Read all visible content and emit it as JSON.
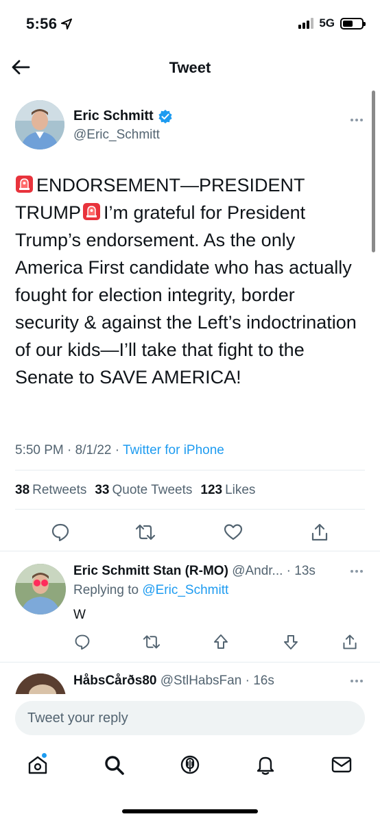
{
  "status_bar": {
    "time": "5:56",
    "network": "5G",
    "battery_level": 0.55
  },
  "header": {
    "title": "Tweet"
  },
  "tweet": {
    "display_name": "Eric Schmitt",
    "handle": "@Eric_Schmitt",
    "verified": true,
    "text_line1": "ENDORSEMENT—PRESIDENT",
    "text_line2_a": "TRUMP",
    "text_line2_b": "I’m grateful for President",
    "text_rest": "Trump’s endorsement. As the only America First candidate who has actually fought for election integrity, border security & against the Left’s indoctrination of our kids—I’ll take that fight to the Senate to SAVE AMERICA!",
    "time": "5:50 PM",
    "date": "8/1/22",
    "source": "Twitter for iPhone",
    "retweets_count": "38",
    "retweets_label": "Retweets",
    "quotes_count": "33",
    "quotes_label": "Quote Tweets",
    "likes_count": "123",
    "likes_label": "Likes"
  },
  "replies": [
    {
      "display_name": "Eric Schmitt Stan (R-MO)",
      "handle": "@Andr...",
      "age": "13s",
      "replying_label": "Replying to",
      "replying_to": "@Eric_Schmitt",
      "text": "W"
    },
    {
      "display_name": "HåbsCårðs80",
      "handle": "@StlHabsFan",
      "age": "16s"
    }
  ],
  "composer": {
    "placeholder": "Tweet your reply"
  },
  "tabs": [
    "home-icon",
    "search-icon",
    "spaces-icon",
    "notifications-icon",
    "messages-icon"
  ],
  "colors": {
    "accent": "#1d9bf0",
    "muted": "#536471",
    "text": "#0f1419"
  }
}
